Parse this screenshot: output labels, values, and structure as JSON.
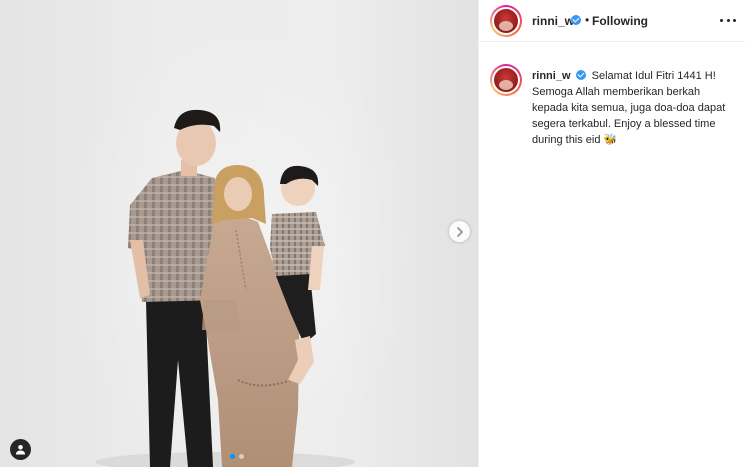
{
  "post": {
    "username": "rinni_w",
    "separator": "•",
    "follow_status": "Following",
    "more_icon": "more-options-icon",
    "caption": "Selamat Idul Fitri 1441 H! Semoga Allah memberikan berkah kepada kita semua, juga doa-doa dapat segera terkabul. Enjoy a blessed time during this eid ",
    "caption_emoji": "🐝",
    "carousel": {
      "total_images": 2,
      "current_index": 1
    }
  },
  "icons": {
    "verified": "verified-badge-icon",
    "next": "chevron-right-icon",
    "user_tag": "user-tag-icon"
  },
  "colors": {
    "accent": "#0095f6",
    "verified": "#3897f0",
    "text": "#262626",
    "border": "#dbdbdb"
  }
}
